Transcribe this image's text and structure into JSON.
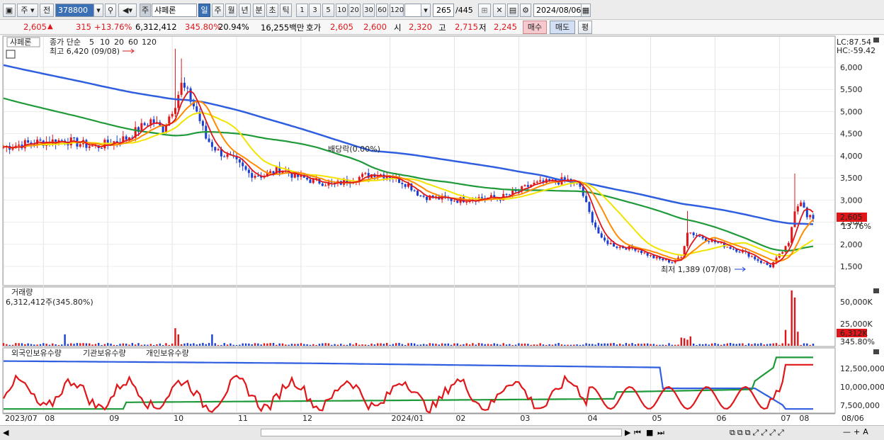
{
  "toolbar": {
    "market": "주",
    "prev_label": "전",
    "code": "378800",
    "stock_type": "주",
    "stock_name": "샤페론",
    "periods": [
      "일",
      "주",
      "월",
      "년",
      "분",
      "초",
      "틱"
    ],
    "intervals": [
      "1",
      "3",
      "5",
      "10",
      "20",
      "30",
      "60",
      "120"
    ],
    "count": "265",
    "total": "/445",
    "date": "2024/08/06"
  },
  "quote": {
    "price": "2,605",
    "arrow": "▲",
    "change": "315",
    "change_pct": "+13.76%",
    "volume": "6,312,412",
    "volume_ratio": "345.80%",
    "turnover": "20.94%",
    "amount": "16,255백만",
    "ask_label": "호가",
    "ask": "2,605",
    "bid": "2,600",
    "open_label": "시",
    "open": "2,320",
    "high_label": "고",
    "high": "2,715",
    "low_label": "저",
    "low": "2,245",
    "buy_btn": "매수",
    "sell_btn": "매도",
    "eval_btn": "평"
  },
  "price_panel": {
    "name": "샤페론",
    "ma_label": "종가 단순",
    "ma": [
      {
        "period": "5",
        "color": "#e0171a"
      },
      {
        "period": "10",
        "color": "#ff8c00"
      },
      {
        "period": "20",
        "color": "#f2e400"
      },
      {
        "period": "60",
        "color": "#1f9a3a"
      },
      {
        "period": "120",
        "color": "#2f5fe0"
      }
    ],
    "high_note": "최고 6,420 (09/08)",
    "low_note": "최저 1,389 (07/08)",
    "dividend_note": "배당락(0.00%)",
    "lc": "LC:87.54",
    "hc": "HC:-59.42",
    "price_tag": "2,605",
    "pct_tag": "13.76%",
    "y_ticks": [
      "6,000",
      "5,500",
      "5,000",
      "4,500",
      "4,000",
      "3,500",
      "3,000",
      "2,500",
      "2,000",
      "1,500"
    ]
  },
  "volume_panel": {
    "title": "거래량",
    "value": "6,312,412주(345.80%)",
    "y_ticks": [
      "50,000K",
      "25,000K"
    ],
    "tag": "6,312K",
    "tag_pct": "345.80%"
  },
  "holding_panel": {
    "series": [
      "외국인보유수량",
      "기관보유수량",
      "개인보유수량"
    ],
    "colors": [
      "#e0171a",
      "#2f5fe0",
      "#1f9a3a"
    ],
    "y_ticks": [
      "12,500,000",
      "10,000,000",
      "7,500,000"
    ]
  },
  "x_axis": [
    "2023/07",
    "08",
    "09",
    "10",
    "11",
    "12",
    "2024/01",
    "02",
    "03",
    "04",
    "05",
    "06",
    "07",
    "08"
  ],
  "right_date": "08/06",
  "colors": {
    "up": "#e0171a",
    "down": "#1b3fd1",
    "accent": "#3b6fb6"
  }
}
